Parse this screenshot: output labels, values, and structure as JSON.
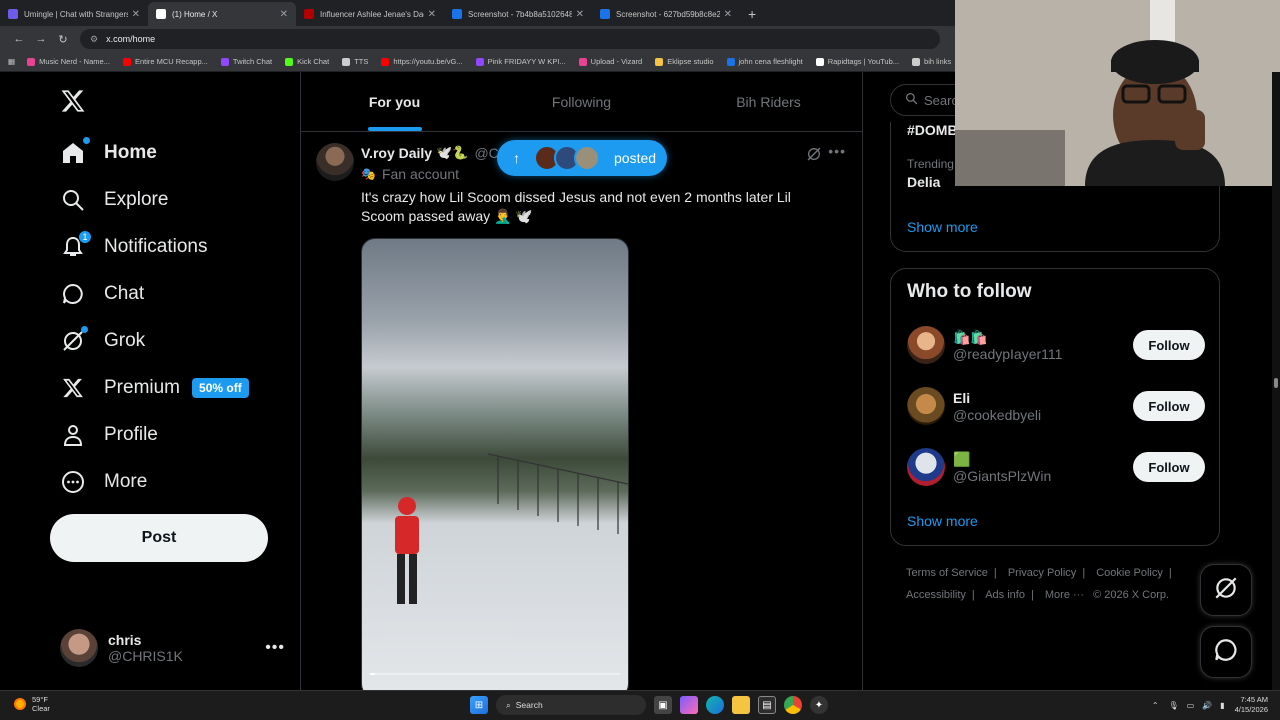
{
  "browser": {
    "tabs": [
      {
        "label": "Umingle | Chat with Strangers",
        "color": "#6c5ce7"
      },
      {
        "label": "(1) Home / X",
        "color": "#ffffff"
      },
      {
        "label": "Influencer Ashlee Jenae's Dad",
        "color": "#b30000"
      },
      {
        "label": "Screenshot - 7b4b8a5102648d",
        "color": "#1a73e8"
      },
      {
        "label": "Screenshot - 627bd59b8c8e27",
        "color": "#1a73e8"
      }
    ],
    "url": "x.com/home",
    "bookmarks": [
      {
        "label": "Music Nerd - Name...",
        "color": "#e84393"
      },
      {
        "label": "Entire MCU Recapp...",
        "color": "#ff0000"
      },
      {
        "label": "Twitch Chat",
        "color": "#9146ff"
      },
      {
        "label": "Kick Chat",
        "color": "#53fc18"
      },
      {
        "label": "TTS",
        "color": "#cccccc"
      },
      {
        "label": "https://youtu.be/vG...",
        "color": "#ff0000"
      },
      {
        "label": "Pink FRIDAYY W KPI...",
        "color": "#9146ff"
      },
      {
        "label": "Upload - Vizard",
        "color": "#e84393"
      },
      {
        "label": "Eklipse studio",
        "color": "#f5c542"
      },
      {
        "label": "john cena fleshlight",
        "color": "#1a73e8"
      },
      {
        "label": "Rapidtags | YouTub...",
        "color": "#ffffff"
      },
      {
        "label": "bih links",
        "color": "#cccccc"
      }
    ]
  },
  "sidebar": {
    "items": [
      {
        "label": "Home",
        "icon": "home-icon"
      },
      {
        "label": "Explore",
        "icon": "search-icon"
      },
      {
        "label": "Notifications",
        "icon": "bell-icon",
        "badge": "1"
      },
      {
        "label": "Chat",
        "icon": "chat-icon"
      },
      {
        "label": "Grok",
        "icon": "grok-icon"
      },
      {
        "label": "Premium",
        "icon": "x-icon",
        "promo": "50% off"
      },
      {
        "label": "Profile",
        "icon": "person-icon"
      },
      {
        "label": "More",
        "icon": "more-circle-icon"
      }
    ],
    "post_label": "Post",
    "account": {
      "name": "chris",
      "handle": "@CHRIS1K"
    }
  },
  "feed": {
    "tabs": [
      "For you",
      "Following",
      "Bih Riders"
    ],
    "posted_label": "posted",
    "tweet": {
      "name": "V.roy Daily",
      "handle": "@Cl",
      "label": "Fan account",
      "text": "It's crazy how Lil Scoom dissed Jesus and not even 2 months later Lil Scoom passed away 🤦‍♂️ 🕊️",
      "video_progress": 0.02
    }
  },
  "right": {
    "search_placeholder": "Search",
    "trend_top": "#DOMB",
    "trend_meta": "Trending",
    "trend_name": "Delia",
    "show_more": "Show more",
    "wtf_title": "Who to follow",
    "follow_label": "Follow",
    "suggestions": [
      {
        "name": "🛍️🛍️",
        "handle": "@readypIayer111"
      },
      {
        "name": "Eli",
        "handle": "@cookedbyeli"
      },
      {
        "name": "🟩",
        "handle": "@GiantsPlzWin"
      }
    ],
    "footer": [
      "Terms of Service",
      "Privacy Policy",
      "Cookie Policy",
      "Accessibility",
      "Ads info",
      "More ···",
      "© 2026 X Corp."
    ]
  },
  "taskbar": {
    "temp": "59°F",
    "condition": "Clear",
    "search_label": "Search",
    "time": "7:45 AM",
    "date": "4/15/2026"
  },
  "colors": {
    "accent": "#1d9bf0",
    "bg": "#000000",
    "border": "#2f3336",
    "muted": "#71767b"
  }
}
